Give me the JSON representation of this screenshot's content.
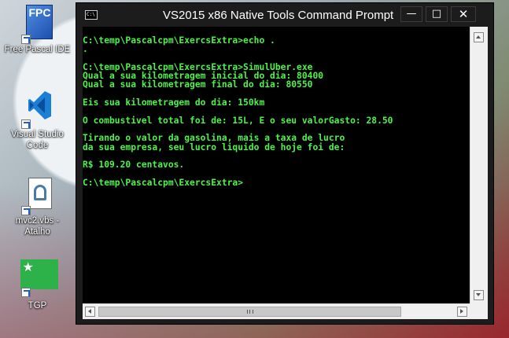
{
  "desktop": {
    "icons": [
      {
        "label": "Free Pascal IDE",
        "glyph": "FPC"
      },
      {
        "label": "Visual Studio\nCode"
      },
      {
        "label": "mvc2.vbs -\nAtalho"
      },
      {
        "label": "TGP"
      }
    ]
  },
  "window": {
    "title": "VS2015 x86 Native Tools Command Prompt",
    "icon_text": "C:\\",
    "buttons": {
      "minimize": "—",
      "maximize": "□",
      "close": "✕"
    }
  },
  "console": {
    "text_color": "#4df24a",
    "lines": [
      "C:\\temp\\Pascalcpm\\ExercsExtra>echo .",
      ".",
      "",
      "C:\\temp\\Pascalcpm\\ExercsExtra>SimulUber.exe",
      "Qual a sua kilometragem inicial do dia: 80400",
      "Qual a sua kilometragem final do dia: 80550",
      "",
      "Eis sua kilometragem do dia: 150km",
      "",
      "O combustivel total foi de: 15L, E o seu valorGasto: 28.50",
      "",
      "Tirando o valor da gasolina, mais a taxa de lucro",
      "da sua empresa, seu lucro liquido de hoje foi de:",
      "",
      "R$ 109.20 centavos.",
      "",
      "C:\\temp\\Pascalcpm\\ExercsExtra>"
    ]
  }
}
